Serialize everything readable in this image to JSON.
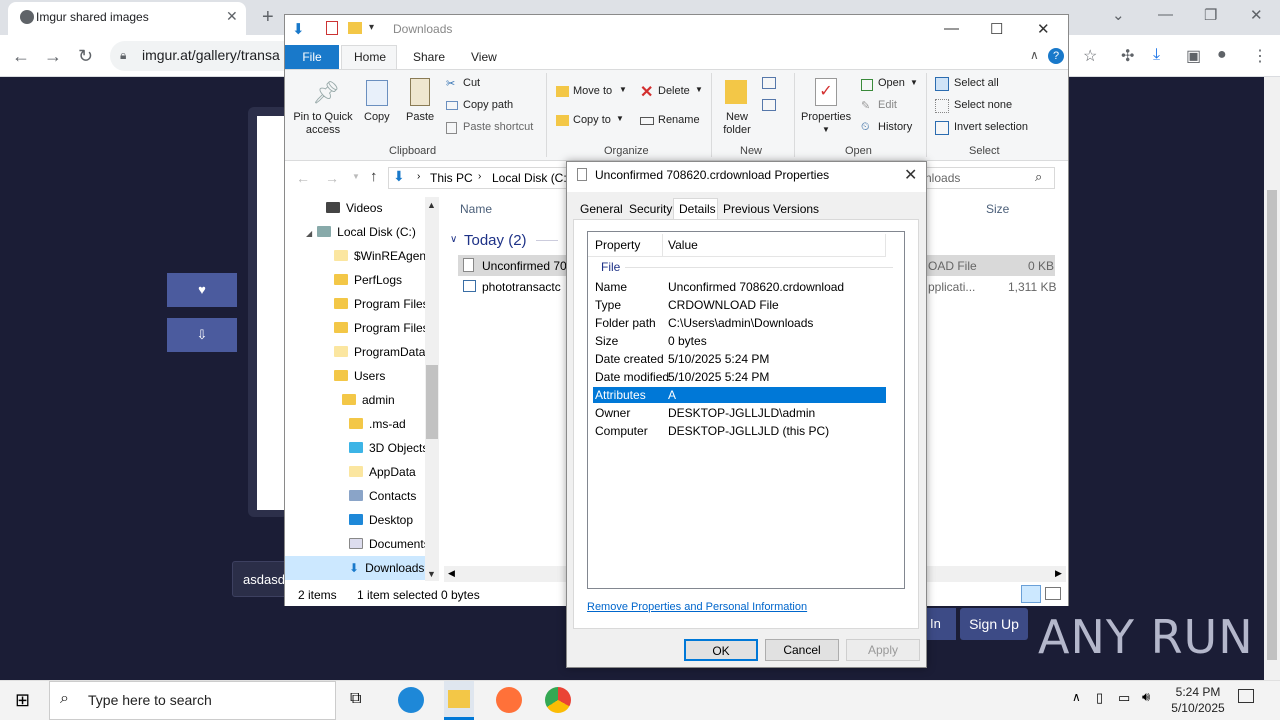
{
  "browser": {
    "tab_title": "Imgur shared images",
    "url": "imgur.at/gallery/transa"
  },
  "page": {
    "side_buttons": [
      "♥",
      "⇩"
    ],
    "input_value": "asdasd",
    "signin_label": "In",
    "signup_label": "Sign Up",
    "watermark": "ANY RUN"
  },
  "explorer": {
    "title": "Downloads",
    "ribbon_tabs": {
      "file": "File",
      "home": "Home",
      "share": "Share",
      "view": "View"
    },
    "clipboard": {
      "pin": "Pin to Quick access",
      "copy": "Copy",
      "paste": "Paste",
      "cut": "Cut",
      "copy_path": "Copy path",
      "paste_shortcut": "Paste shortcut",
      "group": "Clipboard"
    },
    "organize": {
      "move_to": "Move to",
      "copy_to": "Copy to",
      "delete": "Delete",
      "rename": "Rename",
      "group": "Organize"
    },
    "new": {
      "new_folder": "New folder",
      "group": "New"
    },
    "open": {
      "properties": "Properties",
      "open": "Open",
      "edit": "Edit",
      "history": "History",
      "group": "Open"
    },
    "select": {
      "all": "Select all",
      "none": "Select none",
      "invert": "Invert selection",
      "group": "Select"
    },
    "breadcrumb": [
      "This PC",
      "Local Disk (C:)"
    ],
    "search_placeholder": "nloads",
    "nav_items": [
      "Videos",
      "Local Disk (C:)",
      "$WinREAgent",
      "PerfLogs",
      "Program Files",
      "Program Files",
      "ProgramData",
      "Users",
      "admin",
      ".ms-ad",
      "3D Objects",
      "AppData",
      "Contacts",
      "Desktop",
      "Documents",
      "Downloads"
    ],
    "columns": {
      "name": "Name",
      "size": "Size"
    },
    "group_header": "Today (2)",
    "files": [
      {
        "name": "Unconfirmed 70",
        "type": "OAD File",
        "size": "0 KB"
      },
      {
        "name": "phototransactc",
        "type": "pplicati...",
        "size": "1,311 KB"
      }
    ],
    "status": {
      "items": "2 items",
      "selected": "1 item selected",
      "bytes": "0 bytes"
    }
  },
  "dialog": {
    "title": "Unconfirmed 708620.crdownload Properties",
    "tabs": [
      "General",
      "Security",
      "Details",
      "Previous Versions"
    ],
    "header_property": "Property",
    "header_value": "Value",
    "group": "File",
    "rows": [
      {
        "p": "Name",
        "v": "Unconfirmed 708620.crdownload"
      },
      {
        "p": "Type",
        "v": "CRDOWNLOAD File"
      },
      {
        "p": "Folder path",
        "v": "C:\\Users\\admin\\Downloads"
      },
      {
        "p": "Size",
        "v": "0 bytes"
      },
      {
        "p": "Date created",
        "v": "5/10/2025 5:24 PM"
      },
      {
        "p": "Date modified",
        "v": "5/10/2025 5:24 PM"
      },
      {
        "p": "Attributes",
        "v": "A"
      },
      {
        "p": "Owner",
        "v": "DESKTOP-JGLLJLD\\admin"
      },
      {
        "p": "Computer",
        "v": "DESKTOP-JGLLJLD (this PC)"
      }
    ],
    "link": "Remove Properties and Personal Information",
    "ok": "OK",
    "cancel": "Cancel",
    "apply": "Apply"
  },
  "taskbar": {
    "search_placeholder": "Type here to search",
    "time": "5:24 PM",
    "date": "5/10/2025"
  },
  "colors": {
    "accent": "#0078d7",
    "file_tab": "#1979ca",
    "page_bg": "#1b1d36"
  }
}
